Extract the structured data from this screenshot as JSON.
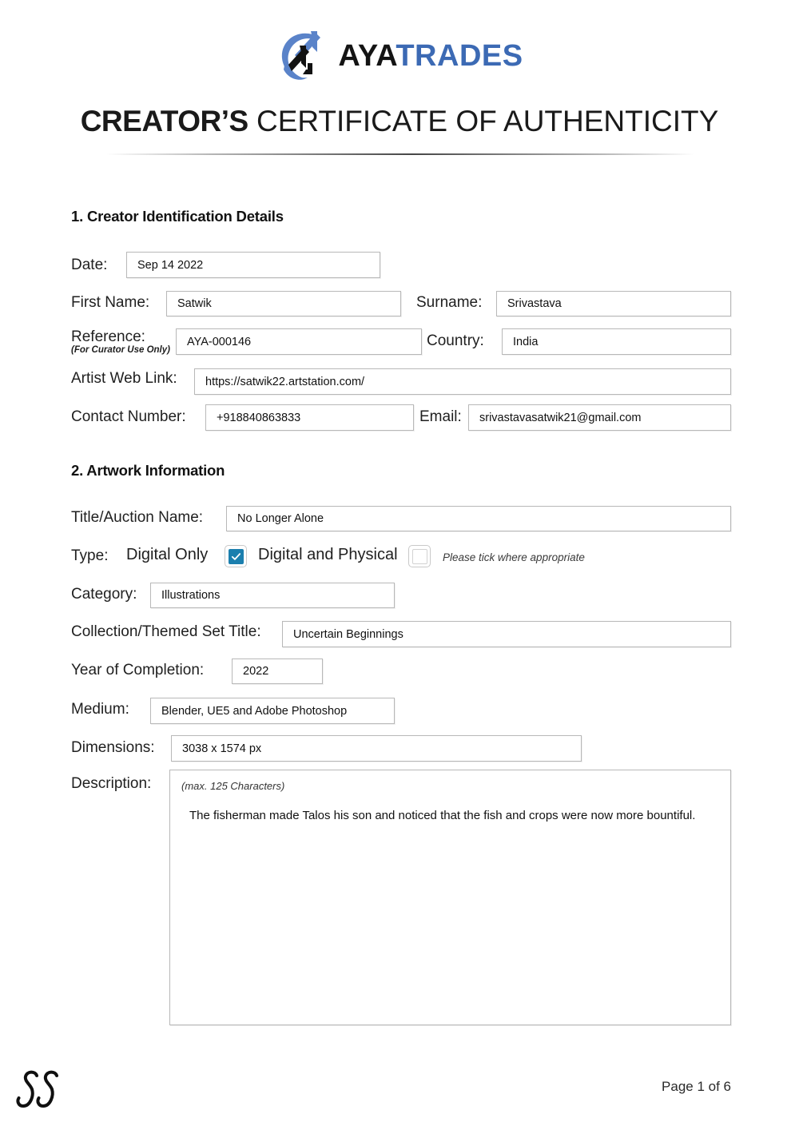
{
  "brand": {
    "name_part1": "AYA",
    "name_part2": "TRADES",
    "logo_icon": "ayatrades-swoosh-logo",
    "accent_blue": "#3c6ab4",
    "logo_arc_blue": "#5a83c9"
  },
  "document": {
    "title_strong": "CREATOR’S",
    "title_rest": " CERTIFICATE OF AUTHENTICITY"
  },
  "section1": {
    "heading": "1. Creator Identification Details",
    "fields": {
      "date_label": "Date:",
      "date_value": "Sep 14 2022",
      "first_name_label": "First Name:",
      "first_name_value": "Satwik",
      "surname_label": "Surname:",
      "surname_value": "Srivastava",
      "reference_label": "Reference:",
      "reference_sublabel": "(For Curator Use Only)",
      "reference_value": "AYA-000146",
      "country_label": "Country:",
      "country_value": "India",
      "web_link_label": "Artist Web Link:",
      "web_link_value": "https://satwik22.artstation.com/",
      "contact_label": "Contact Number:",
      "contact_value": "+918840863833",
      "email_label": "Email:",
      "email_value": "srivastavasatwik21@gmail.com"
    }
  },
  "section2": {
    "heading": "2. Artwork Information",
    "fields": {
      "title_label": "Title/Auction Name:",
      "title_value": "No Longer Alone",
      "type_label": "Type:",
      "type_option_1": "Digital Only",
      "type_option_2": "Digital and Physical",
      "type_note": "Please tick where appropriate",
      "type_option_1_checked": true,
      "type_option_2_checked": false,
      "category_label": "Category:",
      "category_value": "Illustrations",
      "collection_label": "Collection/Themed Set Title:",
      "collection_value": "Uncertain Beginnings",
      "year_label": "Year of Completion:",
      "year_value": "2022",
      "medium_label": "Medium:",
      "medium_value": "Blender, UE5 and Adobe Photoshop",
      "dimensions_label": "Dimensions:",
      "dimensions_value": "3038 x 1574 px",
      "description_label": "Description:",
      "description_hint": "(max. 125 Characters)",
      "description_value": "The fisherman made Talos his son and noticed that the fish and crops were now more bountiful."
    }
  },
  "footer": {
    "signature_icon": "handwritten-ss-signature",
    "page_number": "Page 1 of 6"
  }
}
